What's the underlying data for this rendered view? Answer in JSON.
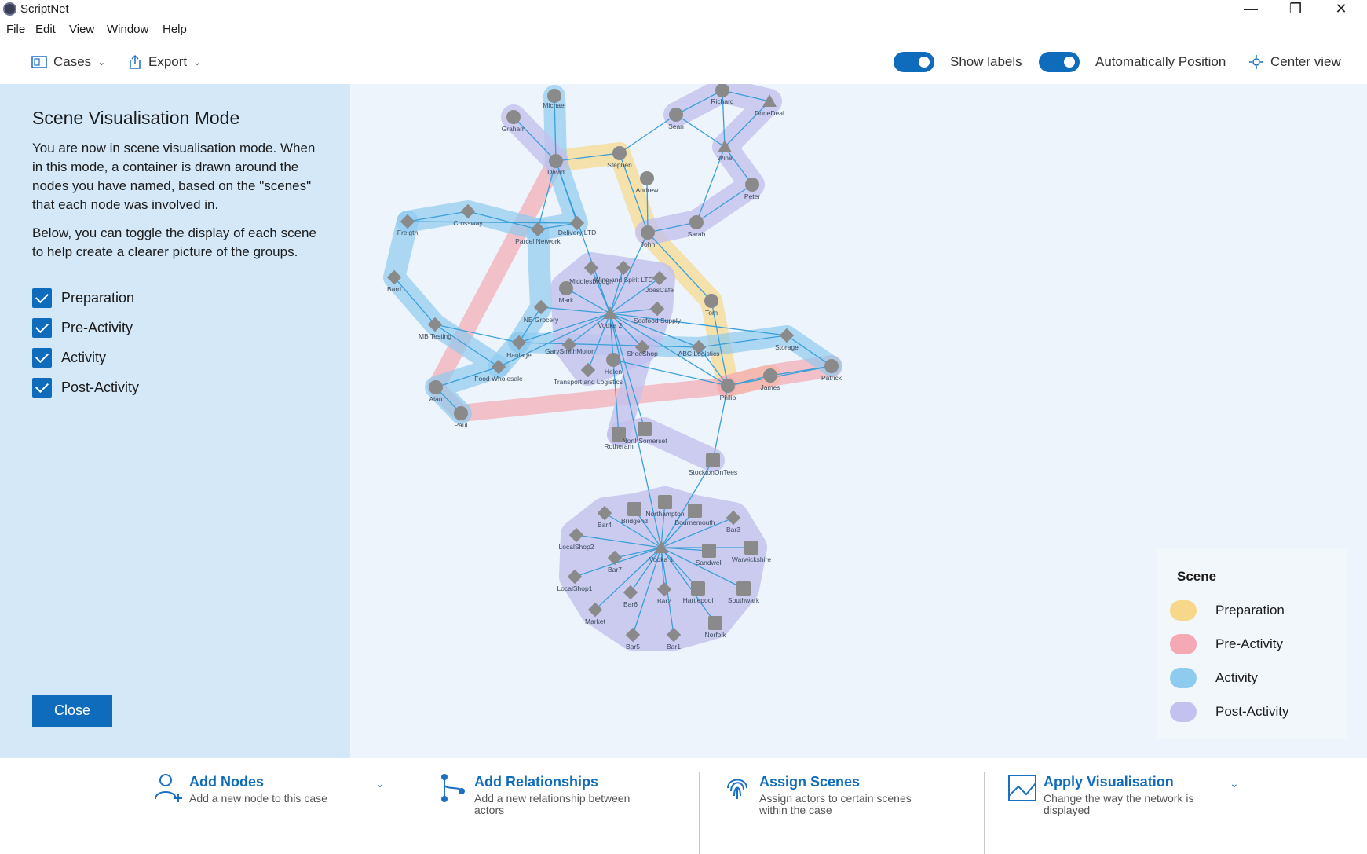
{
  "window": {
    "title": "ScriptNet",
    "minimize": "—",
    "maximize": "❐",
    "close": "✕"
  },
  "menu": [
    "File",
    "Edit",
    "View",
    "Window",
    "Help"
  ],
  "toolbar": {
    "cases_label": "Cases",
    "export_label": "Export",
    "show_labels": "Show labels",
    "auto_position": "Automatically Position",
    "center_view": "Center view",
    "show_labels_on": true,
    "auto_position_on": true
  },
  "panel": {
    "title": "Scene Visualisation Mode",
    "para1": "You are now in scene visualisation mode. When in this mode, a container is drawn around the nodes you have named, based on the \"scenes\" that each node was involved in.",
    "para2": "Below, you can toggle the display of each scene to help create a clearer picture of the groups.",
    "checkboxes": [
      {
        "label": "Preparation",
        "checked": true
      },
      {
        "label": "Pre-Activity",
        "checked": true
      },
      {
        "label": "Activity",
        "checked": true
      },
      {
        "label": "Post-Activity",
        "checked": true
      }
    ],
    "close_label": "Close"
  },
  "legend": {
    "title": "Scene",
    "items": [
      {
        "label": "Preparation",
        "color": "#f7d88a"
      },
      {
        "label": "Pre-Activity",
        "color": "#f4a9b4"
      },
      {
        "label": "Activity",
        "color": "#8fcbef"
      },
      {
        "label": "Post-Activity",
        "color": "#c3c1ee"
      }
    ]
  },
  "actions": [
    {
      "title": "Add Nodes",
      "desc": "Add a new node to this case",
      "icon": "add-person-icon"
    },
    {
      "title": "Add Relationships",
      "desc": "Add a new relationship between actors",
      "icon": "relationship-icon"
    },
    {
      "title": "Assign Scenes",
      "desc": "Assign actors to certain scenes within the case",
      "icon": "fingerprint-icon"
    },
    {
      "title": "Apply Visualisation",
      "desc": "Change the way the network is displayed",
      "icon": "image-icon"
    }
  ],
  "network": {
    "scene_colors": {
      "preparation": "#f7d88a",
      "pre_activity": "#f4a9b4",
      "activity": "#8fcbef",
      "post_activity": "#c3c1ee"
    },
    "node_color": "#8a8a8a",
    "edge_color": "#3a9fd8",
    "nodes": [
      {
        "id": "Michael",
        "label": "Michael",
        "shape": "circle"
      },
      {
        "id": "Graham",
        "label": "Graham",
        "shape": "circle"
      },
      {
        "id": "David",
        "label": "David",
        "shape": "circle"
      },
      {
        "id": "Stephen",
        "label": "Stephen",
        "shape": "circle"
      },
      {
        "id": "Andrew",
        "label": "Andrew",
        "shape": "circle"
      },
      {
        "id": "Sean",
        "label": "Sean",
        "shape": "circle"
      },
      {
        "id": "Richard",
        "label": "Richard",
        "shape": "circle"
      },
      {
        "id": "DoneDeal",
        "label": "DoneDeal",
        "shape": "triangle"
      },
      {
        "id": "Wine",
        "label": "Wine",
        "shape": "triangle"
      },
      {
        "id": "Peter",
        "label": "Peter",
        "shape": "circle"
      },
      {
        "id": "Sarah",
        "label": "Sarah",
        "shape": "circle"
      },
      {
        "id": "John",
        "label": "John",
        "shape": "circle"
      },
      {
        "id": "Freigth",
        "label": "Freigth",
        "shape": "diamond"
      },
      {
        "id": "Crossway",
        "label": "Crossway",
        "shape": "diamond"
      },
      {
        "id": "ParcelNetwork",
        "label": "Parcel Network",
        "shape": "diamond"
      },
      {
        "id": "DeliveryLTD",
        "label": "Delivery LTD",
        "shape": "diamond"
      },
      {
        "id": "Bard",
        "label": "Bard",
        "shape": "diamond"
      },
      {
        "id": "Middlesbrough",
        "label": "Middlesbrough",
        "shape": "diamond"
      },
      {
        "id": "WineSpirit",
        "label": "Wine and Spirit LTD",
        "shape": "diamond"
      },
      {
        "id": "JoesCafe",
        "label": "JoesCafe",
        "shape": "diamond"
      },
      {
        "id": "Mark",
        "label": "Mark",
        "shape": "circle"
      },
      {
        "id": "NEGrocery",
        "label": "NE Grocery",
        "shape": "diamond"
      },
      {
        "id": "Vodka2",
        "label": "Vodka 2",
        "shape": "triangle"
      },
      {
        "id": "SeafoodSupply",
        "label": "Seafood Supply",
        "shape": "diamond"
      },
      {
        "id": "Tom",
        "label": "Tom",
        "shape": "circle"
      },
      {
        "id": "MBTesting",
        "label": "MB Testing",
        "shape": "diamond"
      },
      {
        "id": "Haulage",
        "label": "Haulage",
        "shape": "diamond"
      },
      {
        "id": "GarySmithMotor",
        "label": "GarySmithMotor",
        "shape": "diamond"
      },
      {
        "id": "ShoeShop",
        "label": "ShoeShop",
        "shape": "diamond"
      },
      {
        "id": "ABCLogistics",
        "label": "ABC Logistics",
        "shape": "diamond"
      },
      {
        "id": "Storage",
        "label": "Storage",
        "shape": "diamond"
      },
      {
        "id": "Helen",
        "label": "Helen",
        "shape": "circle"
      },
      {
        "id": "Transport",
        "label": "Transport and Logistics",
        "shape": "diamond"
      },
      {
        "id": "FoodWholesale",
        "label": "Food Wholesale",
        "shape": "diamond"
      },
      {
        "id": "James",
        "label": "James",
        "shape": "circle"
      },
      {
        "id": "Patrick",
        "label": "Patrick",
        "shape": "circle"
      },
      {
        "id": "Philip",
        "label": "Philip",
        "shape": "circle"
      },
      {
        "id": "Alan",
        "label": "Alan",
        "shape": "circle"
      },
      {
        "id": "Paul",
        "label": "Paul",
        "shape": "circle"
      },
      {
        "id": "Rotheram",
        "label": "Rotheram",
        "shape": "square"
      },
      {
        "id": "NorthSomerset",
        "label": "NorthSomerset",
        "shape": "square"
      },
      {
        "id": "StocktonOnTees",
        "label": "StocktonOnTees",
        "shape": "square"
      },
      {
        "id": "Northampton",
        "label": "Northampton",
        "shape": "square"
      },
      {
        "id": "Bridgend",
        "label": "Bridgend",
        "shape": "square"
      },
      {
        "id": "Bournemouth",
        "label": "Bournemouth",
        "shape": "square"
      },
      {
        "id": "Bar4",
        "label": "Bar4",
        "shape": "diamond"
      },
      {
        "id": "Bar3",
        "label": "Bar3",
        "shape": "diamond"
      },
      {
        "id": "LocalShop2",
        "label": "LocalShop2",
        "shape": "diamond"
      },
      {
        "id": "Vodka1",
        "label": "Vodka 1",
        "shape": "triangle"
      },
      {
        "id": "Sandwell",
        "label": "Sandwell",
        "shape": "square"
      },
      {
        "id": "Warwickshire",
        "label": "Warwickshire",
        "shape": "square"
      },
      {
        "id": "Bar7",
        "label": "Bar7",
        "shape": "diamond"
      },
      {
        "id": "LocalShop1",
        "label": "LocalShop1",
        "shape": "diamond"
      },
      {
        "id": "Bar6",
        "label": "Bar6",
        "shape": "diamond"
      },
      {
        "id": "Bar2",
        "label": "Bar2",
        "shape": "diamond"
      },
      {
        "id": "Hartlepool",
        "label": "Hartlepool",
        "shape": "square"
      },
      {
        "id": "Southwark",
        "label": "Southwark",
        "shape": "square"
      },
      {
        "id": "Market",
        "label": "Market",
        "shape": "diamond"
      },
      {
        "id": "Norfolk",
        "label": "Norfolk",
        "shape": "square"
      },
      {
        "id": "Bar5",
        "label": "Bar5",
        "shape": "diamond"
      },
      {
        "id": "Bar1",
        "label": "Bar1",
        "shape": "diamond"
      }
    ],
    "edges": [
      [
        "Michael",
        "David"
      ],
      [
        "Graham",
        "David"
      ],
      [
        "David",
        "Stephen"
      ],
      [
        "David",
        "ParcelNetwork"
      ],
      [
        "David",
        "DeliveryLTD"
      ],
      [
        "David",
        "Vodka2"
      ],
      [
        "Stephen",
        "Sean"
      ],
      [
        "Stephen",
        "John"
      ],
      [
        "Andrew",
        "John"
      ],
      [
        "Sean",
        "Richard"
      ],
      [
        "Richard",
        "DoneDeal"
      ],
      [
        "Richard",
        "Wine"
      ],
      [
        "Sean",
        "Wine"
      ],
      [
        "DoneDeal",
        "Wine"
      ],
      [
        "Wine",
        "Peter"
      ],
      [
        "Wine",
        "Sarah"
      ],
      [
        "Sarah",
        "John"
      ],
      [
        "Sarah",
        "Peter"
      ],
      [
        "John",
        "Vodka2"
      ],
      [
        "John",
        "Tom"
      ],
      [
        "Freigth",
        "Crossway"
      ],
      [
        "Freigth",
        "DeliveryLTD"
      ],
      [
        "Crossway",
        "ParcelNetwork"
      ],
      [
        "ParcelNetwork",
        "DeliveryLTD"
      ],
      [
        "Bard",
        "MBTesting"
      ],
      [
        "MBTesting",
        "FoodWholesale"
      ],
      [
        "MBTesting",
        "Haulage"
      ],
      [
        "FoodWholesale",
        "Vodka2"
      ],
      [
        "FoodWholesale",
        "Alan"
      ],
      [
        "Alan",
        "Paul"
      ],
      [
        "NEGrocery",
        "Haulage"
      ],
      [
        "Haulage",
        "ABCLogistics"
      ],
      [
        "Vodka2",
        "Middlesbrough"
      ],
      [
        "Vodka2",
        "WineSpirit"
      ],
      [
        "Vodka2",
        "JoesCafe"
      ],
      [
        "Vodka2",
        "Mark"
      ],
      [
        "Vodka2",
        "NEGrocery"
      ],
      [
        "Vodka2",
        "SeafoodSupply"
      ],
      [
        "Vodka2",
        "GarySmithMotor"
      ],
      [
        "Vodka2",
        "ShoeShop"
      ],
      [
        "Vodka2",
        "Transport"
      ],
      [
        "Vodka2",
        "Helen"
      ],
      [
        "Vodka2",
        "ABCLogistics"
      ],
      [
        "Vodka2",
        "Storage"
      ],
      [
        "Vodka2",
        "Haulage"
      ],
      [
        "Vodka2",
        "Vodka1"
      ],
      [
        "Vodka2",
        "NorthSomerset"
      ],
      [
        "Vodka2",
        "Philip"
      ],
      [
        "Tom",
        "Philip"
      ],
      [
        "Helen",
        "Rotheram"
      ],
      [
        "Helen",
        "Philip"
      ],
      [
        "ABCLogistics",
        "Philip"
      ],
      [
        "Philip",
        "James"
      ],
      [
        "James",
        "Patrick"
      ],
      [
        "Philip",
        "Patrick"
      ],
      [
        "Philip",
        "StocktonOnTees"
      ],
      [
        "StocktonOnTees",
        "Vodka1"
      ],
      [
        "Storage",
        "Patrick"
      ],
      [
        "ABCLogistics",
        "Storage"
      ],
      [
        "Vodka1",
        "Northampton"
      ],
      [
        "Vodka1",
        "Bridgend"
      ],
      [
        "Vodka1",
        "Bournemouth"
      ],
      [
        "Vodka1",
        "Bar4"
      ],
      [
        "Vodka1",
        "Bar3"
      ],
      [
        "Vodka1",
        "LocalShop2"
      ],
      [
        "Vodka1",
        "Sandwell"
      ],
      [
        "Vodka1",
        "Warwickshire"
      ],
      [
        "Vodka1",
        "Bar7"
      ],
      [
        "Vodka1",
        "LocalShop1"
      ],
      [
        "Vodka1",
        "Bar6"
      ],
      [
        "Vodka1",
        "Bar2"
      ],
      [
        "Vodka1",
        "Hartlepool"
      ],
      [
        "Vodka1",
        "Southwark"
      ],
      [
        "Vodka1",
        "Market"
      ],
      [
        "Vodka1",
        "Norfolk"
      ],
      [
        "Vodka1",
        "Bar5"
      ],
      [
        "Vodka1",
        "Bar1"
      ]
    ]
  }
}
